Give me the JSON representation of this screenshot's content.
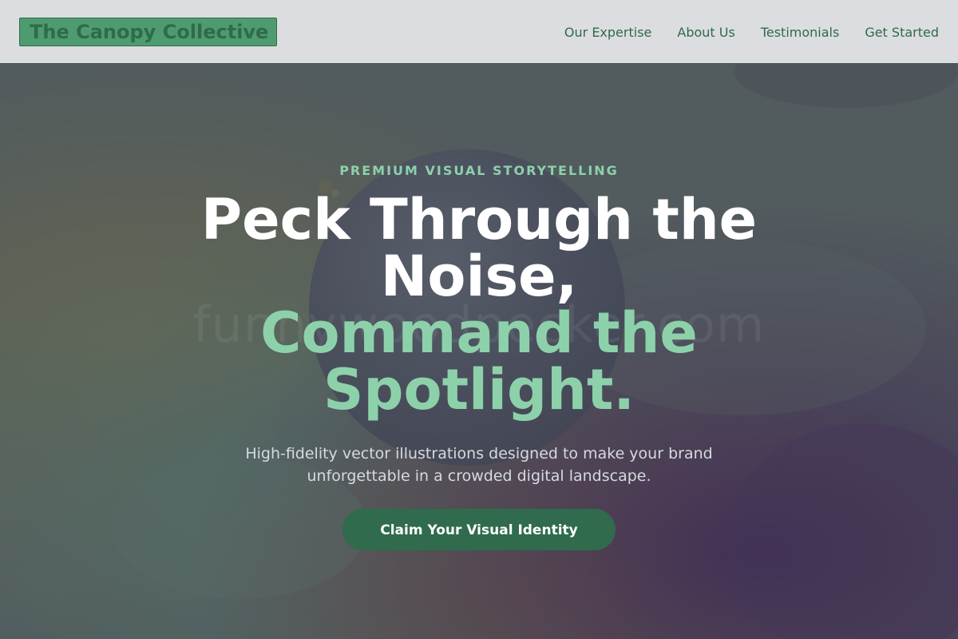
{
  "header": {
    "logo_text": "The Canopy Collective",
    "nav_items": [
      {
        "label": "Our Expertise"
      },
      {
        "label": "About Us"
      },
      {
        "label": "Testimonials"
      },
      {
        "label": "Get Started"
      }
    ]
  },
  "hero": {
    "eyebrow": "PREMIUM VISUAL STORYTELLING",
    "headline_white": "Peck Through the Noise,",
    "headline_green": "Command the Spotlight.",
    "subtext": "High-fidelity vector illustrations designed to make your brand unforgettable in a crowded digital landscape.",
    "cta_label": "Claim Your Visual Identity",
    "watermark": "funnywoodpecker.com"
  },
  "colors": {
    "accent_green": "#8dd1ab",
    "brand_dark_green": "#2f6b4c",
    "header_bg": "#dcdde0",
    "nav_text": "#2e6a4b"
  }
}
